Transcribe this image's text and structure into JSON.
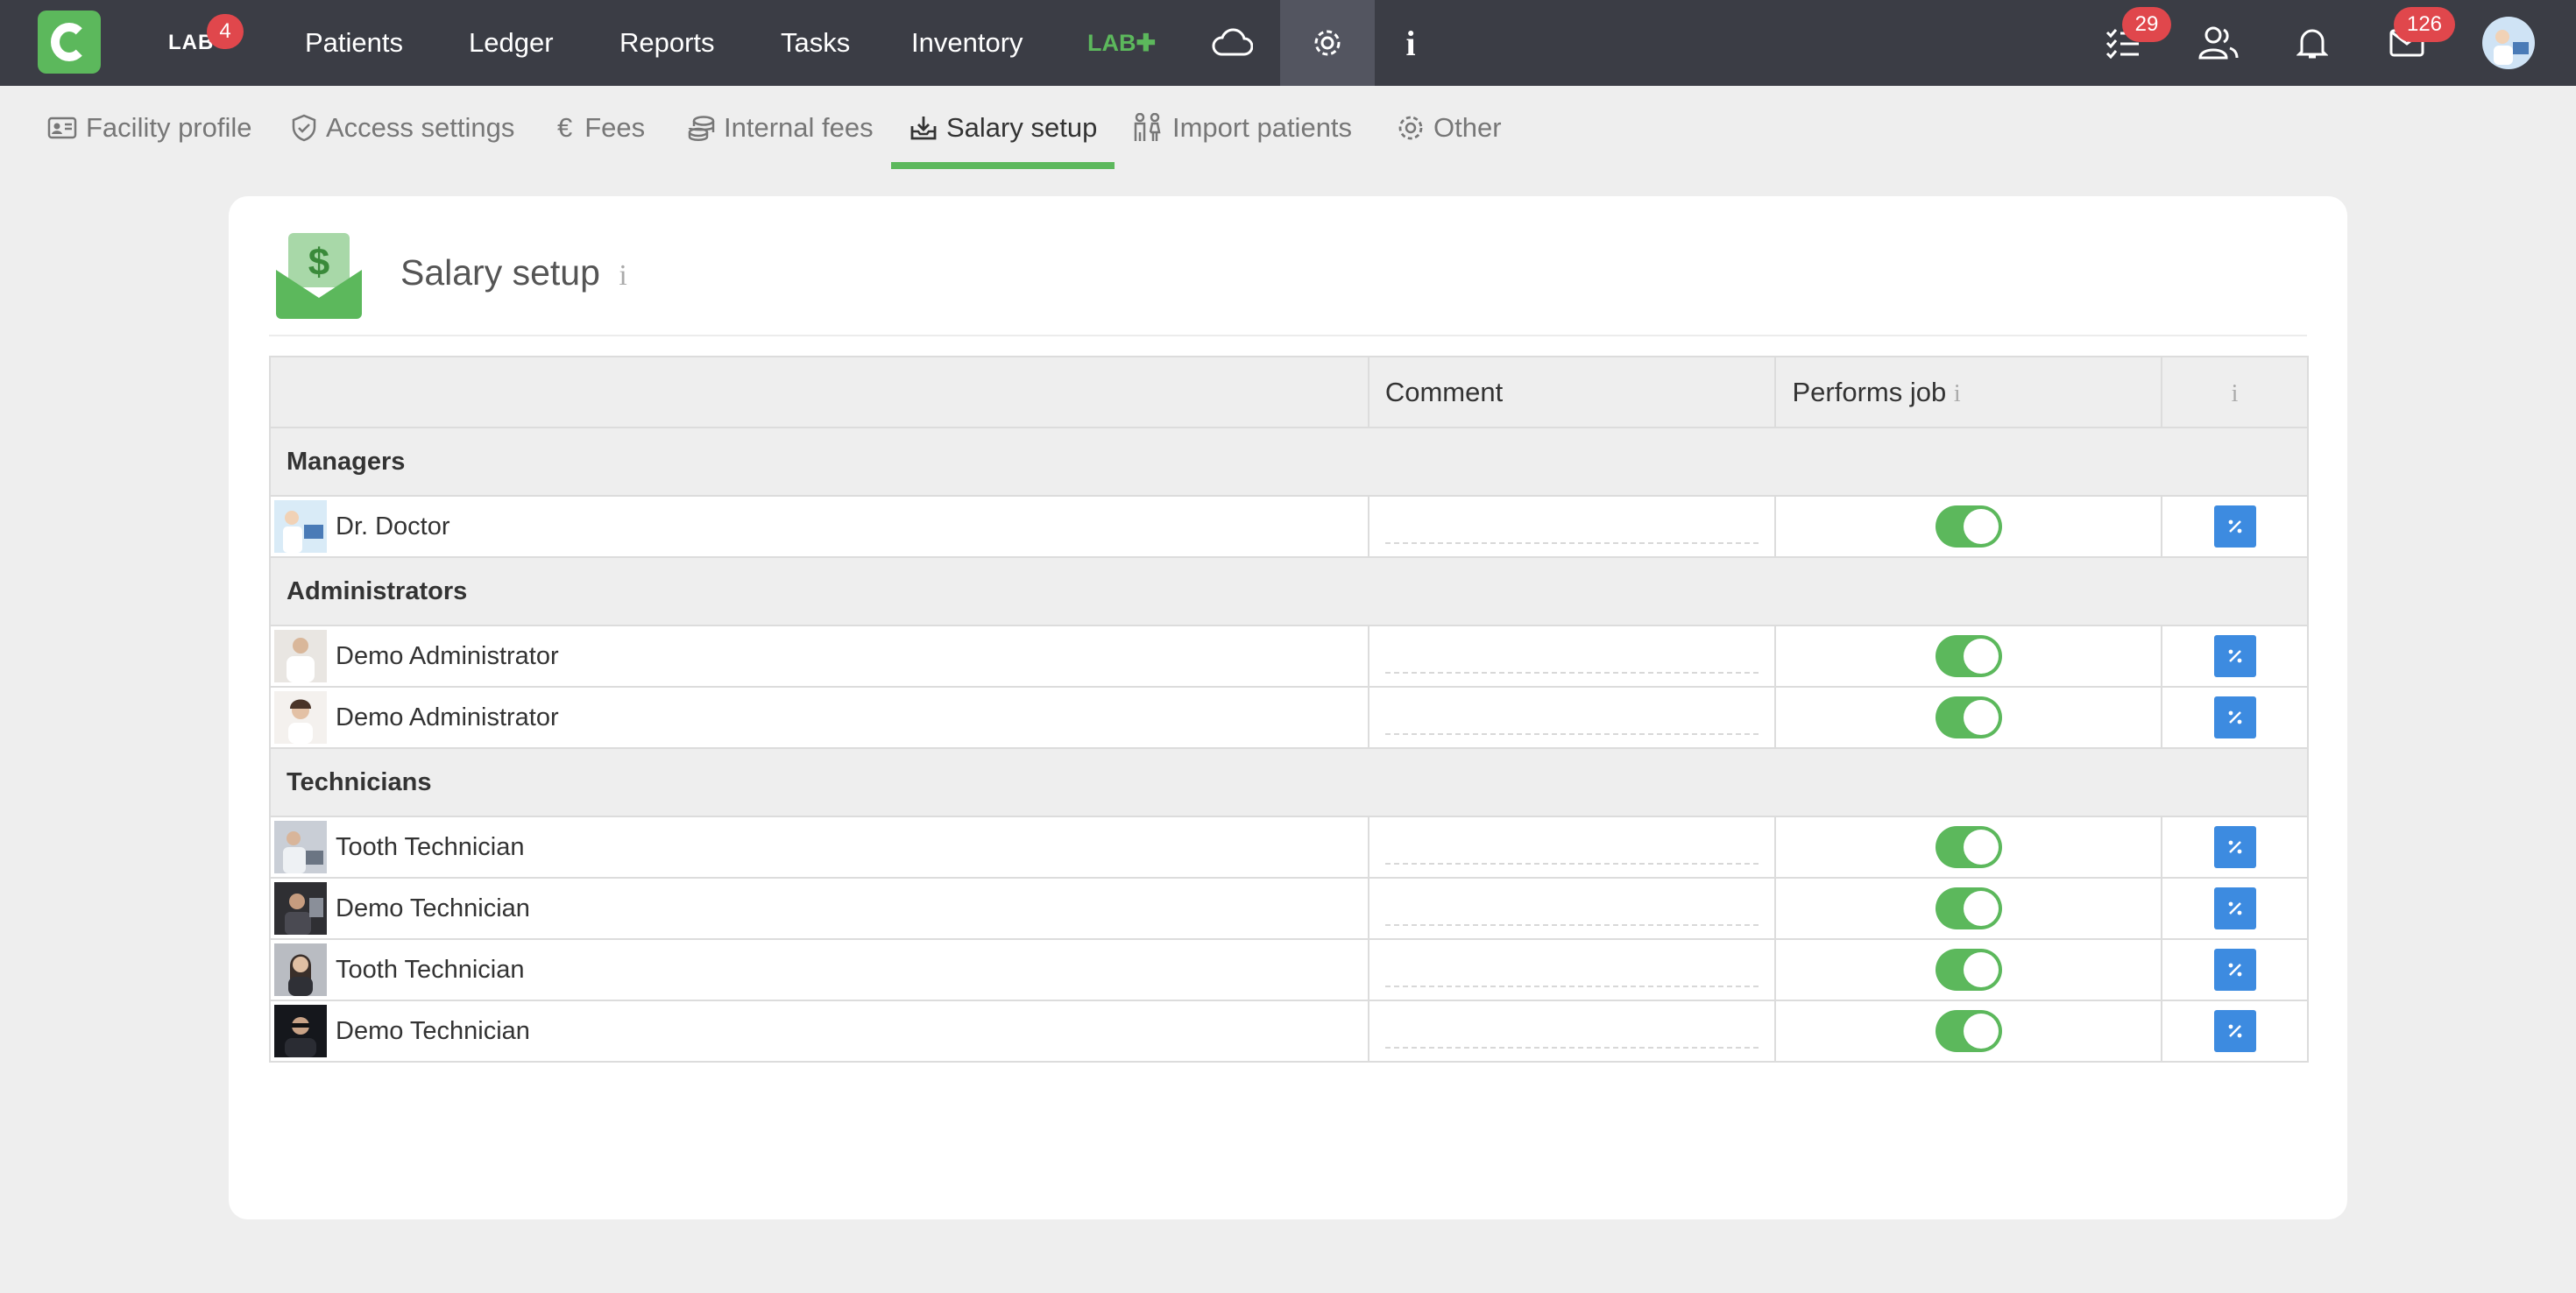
{
  "topbar": {
    "lab_label": "LAB",
    "lab_badge": "4",
    "nav": [
      "Patients",
      "Ledger",
      "Reports",
      "Tasks",
      "Inventory"
    ],
    "labplus_label": "LAB",
    "tasks_badge": "29",
    "messages_badge": "126",
    "icons": [
      "cloud-icon",
      "gear-icon",
      "info-icon",
      "checklist-icon",
      "users-icon",
      "bell-icon",
      "mail-icon"
    ]
  },
  "tabs": [
    {
      "label": "Facility profile",
      "icon": "id-card-icon"
    },
    {
      "label": "Access settings",
      "icon": "shield-check-icon"
    },
    {
      "label": "Fees",
      "icon": "euro-icon"
    },
    {
      "label": "Internal fees",
      "icon": "coins-icon"
    },
    {
      "label": "Salary setup",
      "icon": "download-tray-icon",
      "active": true
    },
    {
      "label": "Import patients",
      "icon": "people-icon"
    },
    {
      "label": "Other",
      "icon": "gear-icon"
    }
  ],
  "card": {
    "title": "Salary setup",
    "info": "i",
    "columns": {
      "name": "",
      "comment": "Comment",
      "performs_job": "Performs job",
      "info": "i"
    },
    "groups": [
      {
        "name": "Managers",
        "people": [
          {
            "name": "Dr. Doctor",
            "comment": "",
            "performs_job": true
          }
        ]
      },
      {
        "name": "Administrators",
        "people": [
          {
            "name": "Demo Administrator",
            "comment": "",
            "performs_job": true
          },
          {
            "name": "Demo Administrator",
            "comment": "",
            "performs_job": true
          }
        ]
      },
      {
        "name": "Technicians",
        "people": [
          {
            "name": "Tooth Technician",
            "comment": "",
            "performs_job": true
          },
          {
            "name": "Demo Technician",
            "comment": "",
            "performs_job": true
          },
          {
            "name": "Tooth Technician",
            "comment": "",
            "performs_job": true
          },
          {
            "name": "Demo Technician",
            "comment": "",
            "performs_job": true
          }
        ]
      }
    ]
  },
  "colors": {
    "topbar": "#3b3d45",
    "accent_green": "#5cb85c",
    "badge_red": "#e0474c",
    "action_blue": "#3d8be0"
  }
}
